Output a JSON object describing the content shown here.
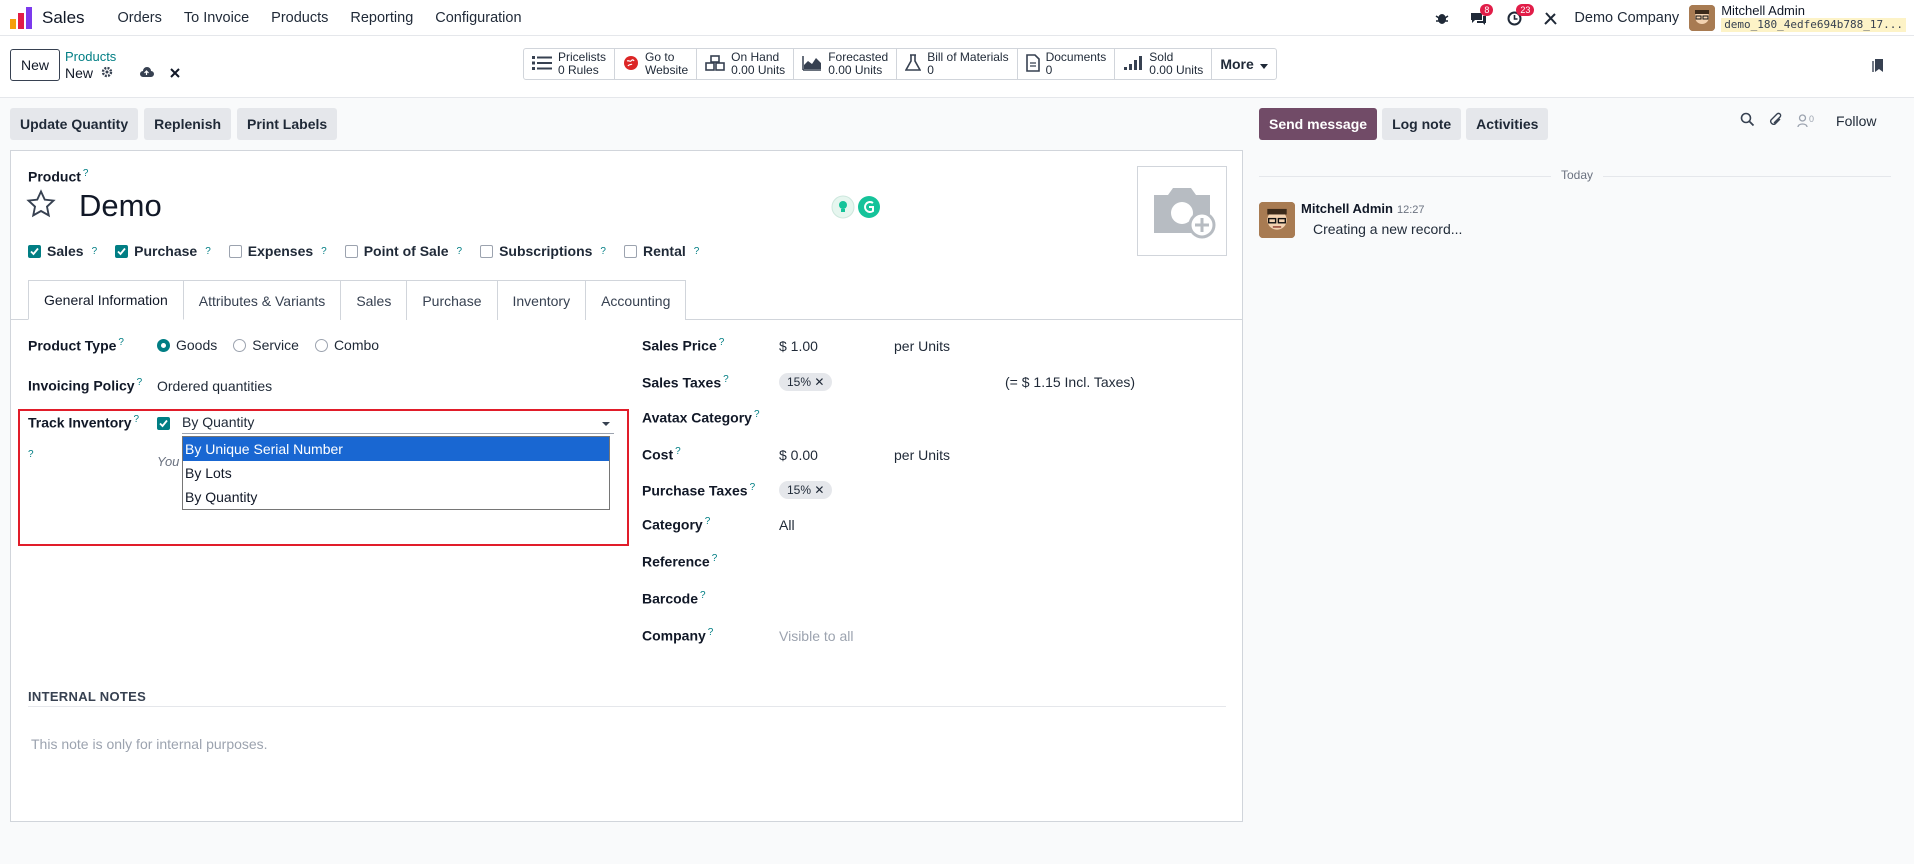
{
  "app": {
    "name": "Sales"
  },
  "nav": {
    "items": [
      "Orders",
      "To Invoice",
      "Products",
      "Reporting",
      "Configuration"
    ]
  },
  "systray": {
    "messages_count": "8",
    "activities_count": "23",
    "company": "Demo Company",
    "user_name": "Mitchell Admin",
    "db_name": "demo_180_4edfe694b788_17..."
  },
  "control": {
    "new_label": "New",
    "breadcrumb_parent": "Products",
    "breadcrumb_current": "New"
  },
  "stats": [
    {
      "icon": "list-icon",
      "title": "Pricelists",
      "value": "0 Rules"
    },
    {
      "icon": "globe-icon",
      "title": "Go to",
      "value": "Website"
    },
    {
      "icon": "boxes-icon",
      "title": "On Hand",
      "value": "0.00 Units"
    },
    {
      "icon": "area-chart-icon",
      "title": "Forecasted",
      "value": "0.00 Units"
    },
    {
      "icon": "flask-icon",
      "title": "Bill of Materials",
      "value": "0"
    },
    {
      "icon": "file-icon",
      "title": "Documents",
      "value": "0"
    },
    {
      "icon": "signal-icon",
      "title": "Sold",
      "value": "0.00 Units"
    }
  ],
  "stats_more": "More",
  "actions": [
    "Update Quantity",
    "Replenish",
    "Print Labels"
  ],
  "chatter": {
    "send_message": "Send message",
    "log_note": "Log note",
    "activities": "Activities",
    "followers_count": "0",
    "follow": "Follow",
    "today": "Today",
    "author": "Mitchell Admin",
    "time": "12:27",
    "body": "Creating a new record..."
  },
  "form": {
    "product_label": "Product",
    "product_name": "Demo",
    "checks": [
      {
        "label": "Sales",
        "checked": true
      },
      {
        "label": "Purchase",
        "checked": true
      },
      {
        "label": "Expenses",
        "checked": false
      },
      {
        "label": "Point of Sale",
        "checked": false
      },
      {
        "label": "Subscriptions",
        "checked": false
      },
      {
        "label": "Rental",
        "checked": false
      }
    ],
    "tabs": [
      "General Information",
      "Attributes & Variants",
      "Sales",
      "Purchase",
      "Inventory",
      "Accounting"
    ],
    "product_type_label": "Product Type",
    "product_type_options": [
      "Goods",
      "Service",
      "Combo"
    ],
    "invoicing_label": "Invoicing Policy",
    "invoicing_value": "Ordered quantities",
    "track_label": "Track Inventory",
    "track_value": "By Quantity",
    "track_hidden_text": "You",
    "track_options": [
      "By Unique Serial Number",
      "By Lots",
      "By Quantity"
    ],
    "sales_price_label": "Sales Price",
    "sales_price": "$ 1.00",
    "per_units": "per Units",
    "sales_taxes_label": "Sales Taxes",
    "sales_tax": "15%",
    "incl_taxes": "(= $ 1.15 Incl. Taxes)",
    "avatax_label": "Avatax Category",
    "cost_label": "Cost",
    "cost": "$ 0.00",
    "purchase_taxes_label": "Purchase Taxes",
    "purchase_tax": "15%",
    "category_label": "Category",
    "category": "All",
    "reference_label": "Reference",
    "barcode_label": "Barcode",
    "company_label": "Company",
    "company_placeholder": "Visible to all",
    "notes_title": "INTERNAL NOTES",
    "notes_placeholder": "This note is only for internal purposes."
  }
}
